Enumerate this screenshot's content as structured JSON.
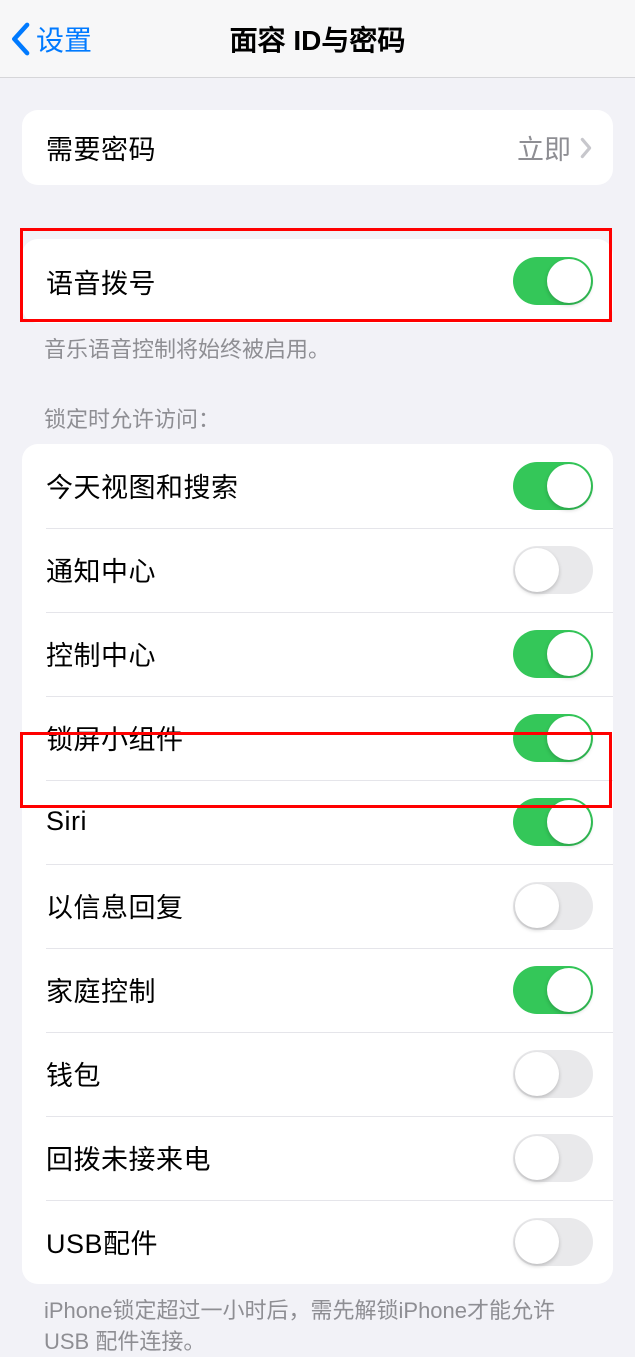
{
  "nav": {
    "back_label": "设置",
    "title": "面容 ID与密码"
  },
  "passcode": {
    "label": "需要密码",
    "value": "立即"
  },
  "voice_dial": {
    "label": "语音拨号",
    "footer": "音乐语音控制将始终被启用。",
    "on": true
  },
  "lock_access": {
    "header": "锁定时允许访问：",
    "items": [
      {
        "label": "今天视图和搜索",
        "on": true
      },
      {
        "label": "通知中心",
        "on": false
      },
      {
        "label": "控制中心",
        "on": true
      },
      {
        "label": "锁屏小组件",
        "on": true
      },
      {
        "label": "Siri",
        "on": true
      },
      {
        "label": "以信息回复",
        "on": false
      },
      {
        "label": "家庭控制",
        "on": true
      },
      {
        "label": "钱包",
        "on": false
      },
      {
        "label": "回拨未接来电",
        "on": false
      },
      {
        "label": "USB配件",
        "on": false
      }
    ],
    "footer": "iPhone锁定超过一小时后，需先解锁iPhone才能允许 USB 配件连接。"
  }
}
